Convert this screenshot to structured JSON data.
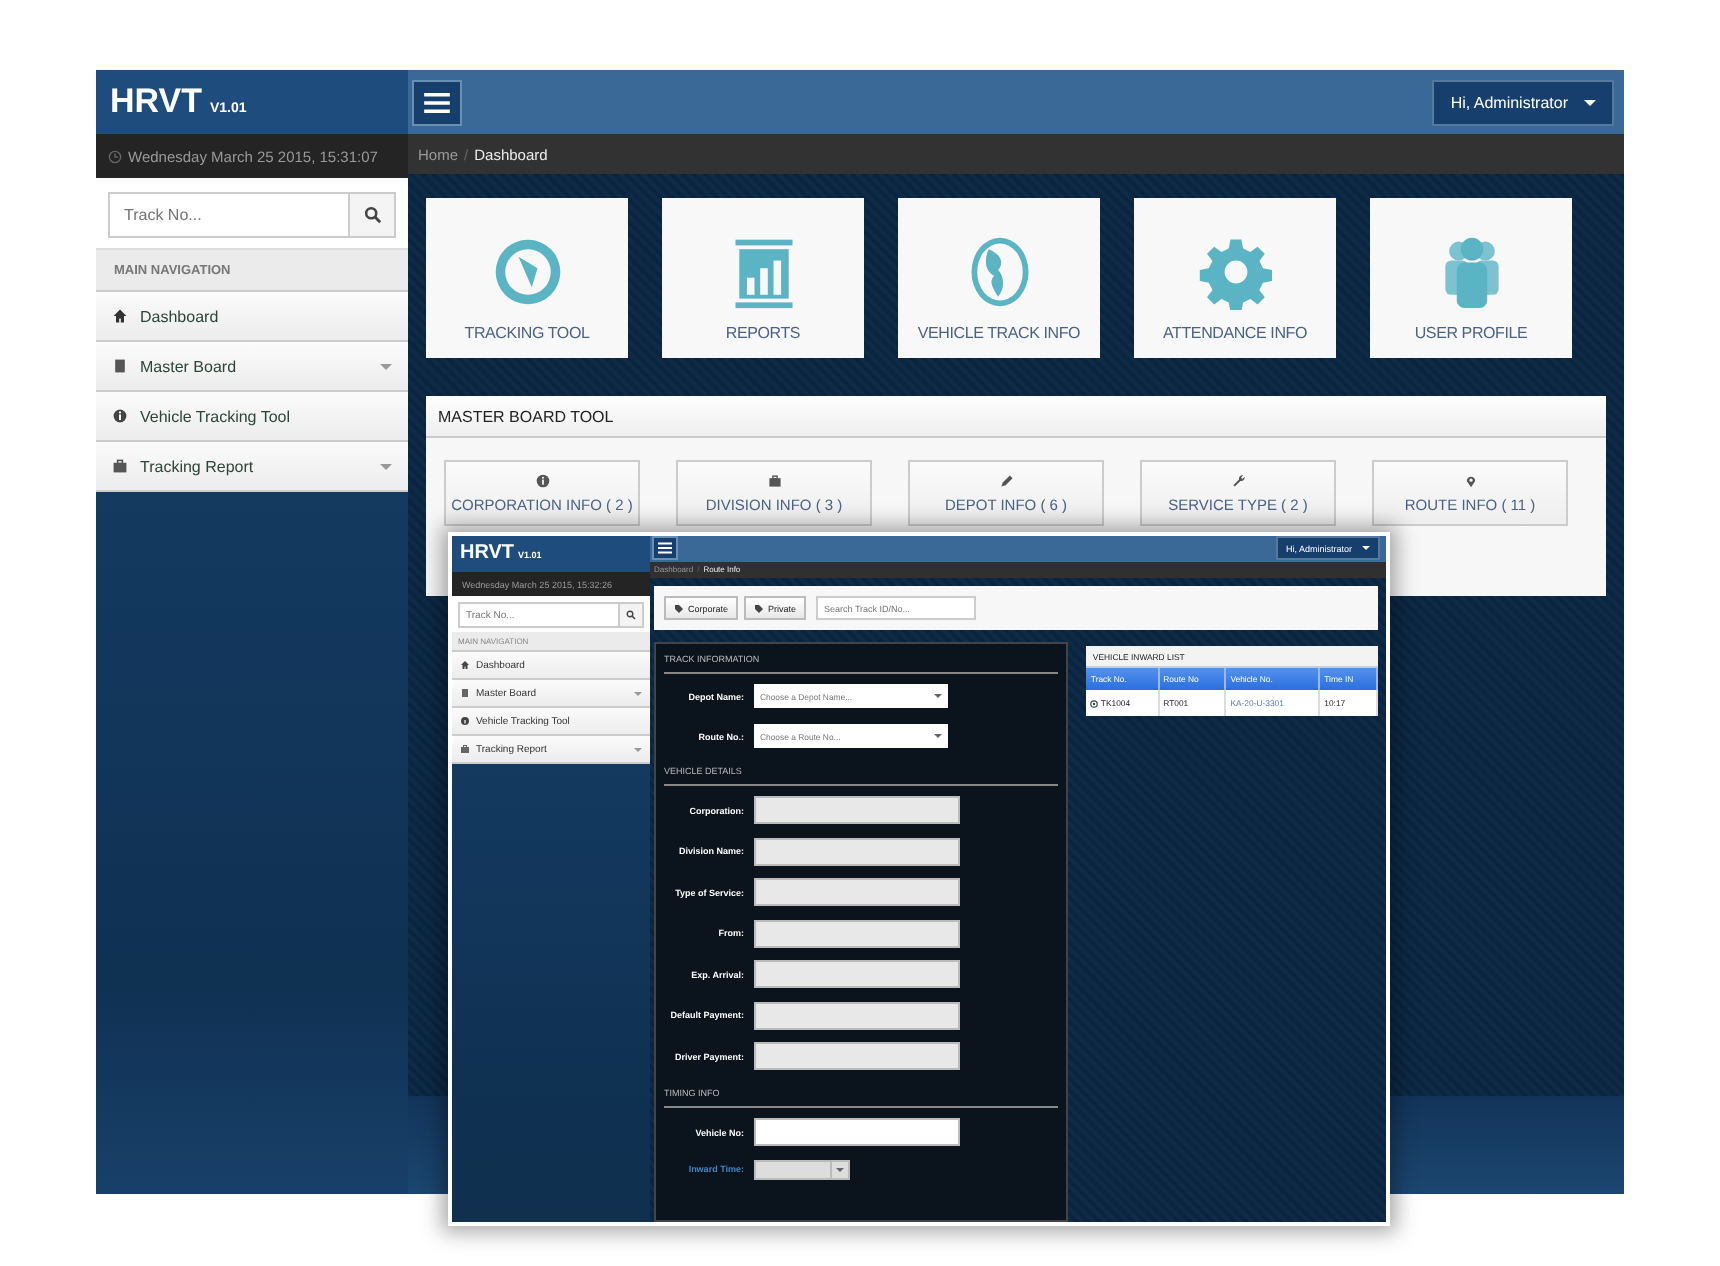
{
  "back": {
    "brand": "HRVT",
    "version": "V1.01",
    "datetime": "Wednesday March 25 2015, 15:31:07",
    "search": {
      "placeholder": "Track No..."
    },
    "nav_header": "MAIN NAVIGATION",
    "nav": [
      {
        "label": "Dashboard",
        "expandable": false
      },
      {
        "label": "Master Board",
        "expandable": true
      },
      {
        "label": "Vehicle Tracking Tool",
        "expandable": false
      },
      {
        "label": "Tracking Report",
        "expandable": true
      }
    ],
    "user": "Hi, Administrator",
    "breadcrumb": [
      "Home",
      "Dashboard"
    ],
    "breadcrumb_separator": "/",
    "tiles": [
      "TRACKING TOOL",
      "REPORTS",
      "VEHICLE TRACK INFO",
      "ATTENDANCE INFO",
      "USER PROFILE"
    ],
    "panel": {
      "title": "MASTER BOARD TOOL",
      "buttons": [
        "CORPORATION INFO ( 2 )",
        "DIVISION INFO ( 3 )",
        "DEPOT INFO ( 6 )",
        "SERVICE TYPE ( 2 )",
        "ROUTE INFO ( 11 )"
      ]
    }
  },
  "front": {
    "brand": "HRVT",
    "version": "V1.01",
    "datetime": "Wednesday March 25 2015, 15:32:26",
    "search": {
      "placeholder": "Track No..."
    },
    "nav_header": "MAIN NAVIGATION",
    "nav": [
      {
        "label": "Dashboard",
        "expandable": false
      },
      {
        "label": "Master Board",
        "expandable": true
      },
      {
        "label": "Vehicle Tracking Tool",
        "expandable": false
      },
      {
        "label": "Tracking Report",
        "expandable": true
      }
    ],
    "user": "Hi, Administrator",
    "breadcrumb": [
      "Dashboard",
      "Route Info"
    ],
    "breadcrumb_separator": "/",
    "toolbar": {
      "buttons": [
        "Corporate",
        "Private"
      ],
      "search": {
        "placeholder": "Search Track ID/No..."
      }
    },
    "form": [
      {
        "title": "TRACK INFORMATION",
        "fields": [
          {
            "label": "Depot Name:",
            "kind": "select",
            "placeholder": "Choose a Depot Name..."
          },
          {
            "label": "Route No.:",
            "kind": "select",
            "placeholder": "Choose a Route No..."
          }
        ]
      },
      {
        "title": "VEHICLE DETAILS",
        "fields": [
          {
            "label": "Corporation:",
            "kind": "readonly"
          },
          {
            "label": "Division Name:",
            "kind": "readonly"
          },
          {
            "label": "Type of Service:",
            "kind": "readonly"
          },
          {
            "label": "From:",
            "kind": "readonly"
          },
          {
            "label": "Exp. Arrival:",
            "kind": "readonly"
          },
          {
            "label": "Default Payment:",
            "kind": "readonly"
          },
          {
            "label": "Driver Payment:",
            "kind": "readonly"
          }
        ]
      },
      {
        "title": "TIMING INFO",
        "fields": [
          {
            "label": "Vehicle No:",
            "kind": "input"
          },
          {
            "label": "Inward Time:",
            "kind": "time"
          }
        ]
      }
    ],
    "inward": {
      "title": "VEHICLE INWARD LIST",
      "columns": [
        "Track No.",
        "Route No",
        "Vehicle No.",
        "Time IN"
      ],
      "rows": [
        [
          "TK1004",
          "RT001",
          "KA-20-U-3301",
          "10:17"
        ]
      ]
    }
  }
}
